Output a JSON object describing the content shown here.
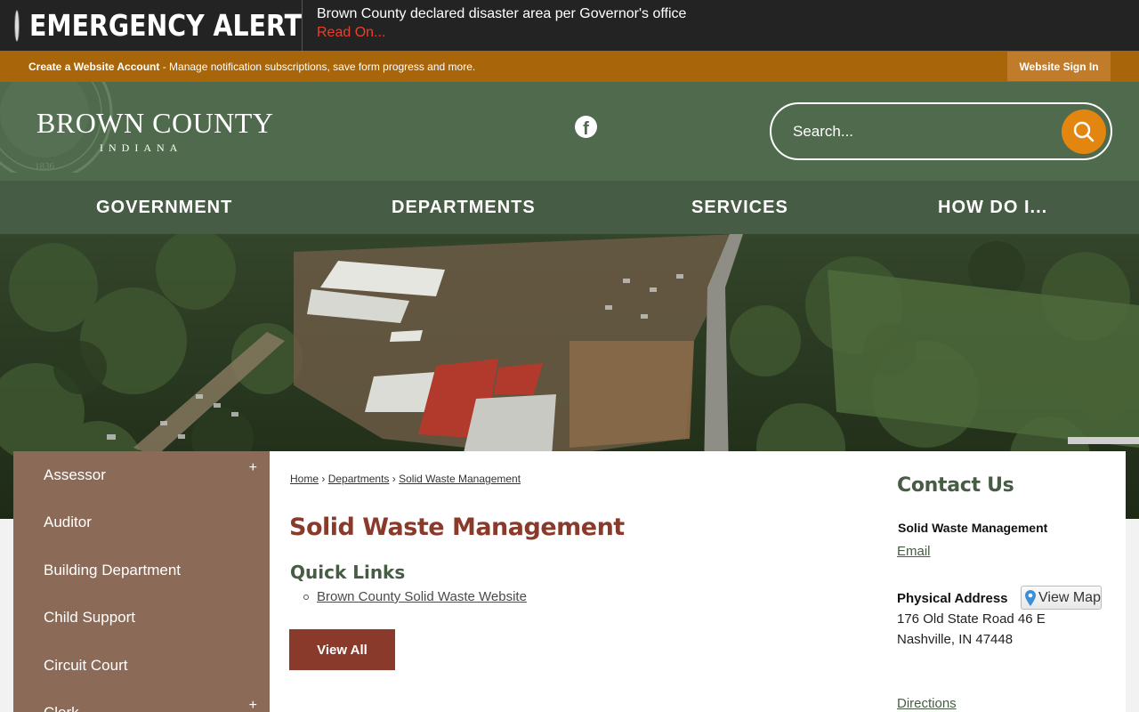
{
  "alert": {
    "title": "EMERGENCY ALERT",
    "message": "Brown County declared disaster area per Governor's office",
    "link": "Read On..."
  },
  "account_bar": {
    "create_label": "Create a Website Account",
    "description": " - Manage notification subscriptions, save form progress and more.",
    "signin_label": "Website Sign In"
  },
  "header": {
    "logo_main": "BROWN COUNTY",
    "logo_sub": "INDIANA",
    "search_placeholder": "Search..."
  },
  "nav": {
    "items": [
      "GOVERNMENT",
      "DEPARTMENTS",
      "SERVICES",
      "HOW DO I..."
    ]
  },
  "sidebar": {
    "items": [
      {
        "label": "Assessor",
        "expand": "+"
      },
      {
        "label": "Auditor"
      },
      {
        "label": "Building Department"
      },
      {
        "label": "Child Support"
      },
      {
        "label": "Circuit Court"
      },
      {
        "label": "Clerk",
        "expand": "+"
      }
    ]
  },
  "breadcrumb": {
    "home": "Home",
    "departments": "Departments",
    "current": "Solid Waste Management",
    "separator": "›"
  },
  "main": {
    "title": "Solid Waste Management",
    "quick_links_title": "Quick Links",
    "quick_links": [
      "Brown County Solid Waste Website"
    ],
    "view_all": "View All"
  },
  "contact": {
    "title": "Contact Us",
    "department": "Solid Waste Management",
    "email": "Email",
    "physical_address_label": "Physical Address",
    "view_map": "View Map",
    "address_line1": "176 Old State Road 46 E",
    "address_line2": "Nashville, IN 47448",
    "directions": "Directions"
  },
  "colors": {
    "header_green": "#4f6a4c",
    "nav_green": "#465c44",
    "account_orange": "#a8650a",
    "search_orange": "#e3860f",
    "sidebar_brown": "#8b6b58",
    "title_red": "#8a3a2b",
    "alert_red": "#e8402c"
  }
}
